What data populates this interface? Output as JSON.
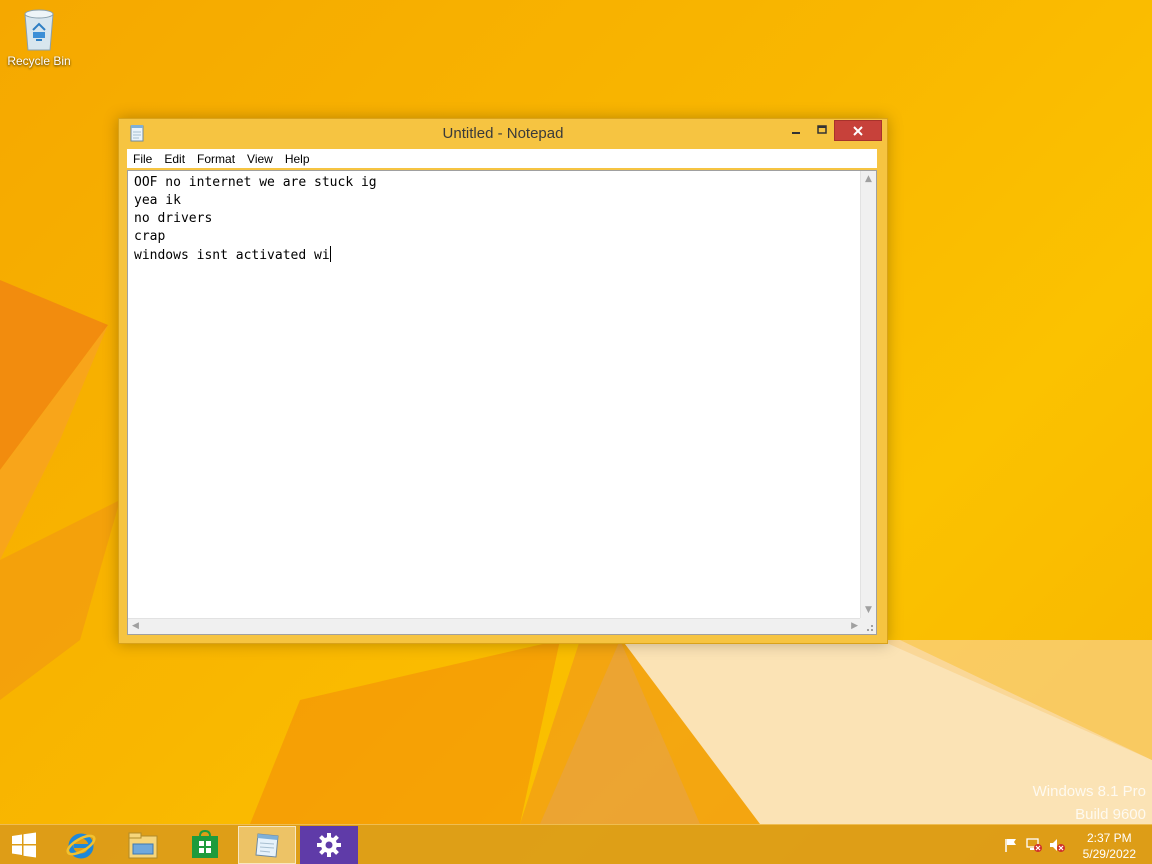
{
  "desktop": {
    "icons": [
      {
        "label": "Recycle Bin",
        "icon": "recycle-bin-icon"
      }
    ],
    "watermark": {
      "line1": "Windows 8.1 Pro",
      "line2": "Build 9600"
    }
  },
  "notepad": {
    "title": "Untitled - Notepad",
    "menu": [
      "File",
      "Edit",
      "Format",
      "View",
      "Help"
    ],
    "content_lines": [
      "OOF no internet we are stuck ig",
      "yea ik",
      "no drivers",
      "crap",
      "windows isnt activated wi"
    ],
    "close_color": "#c7413a"
  },
  "taskbar": {
    "buttons": [
      {
        "icon": "windows-start-icon",
        "active": false
      },
      {
        "icon": "internet-explorer-icon",
        "active": false
      },
      {
        "icon": "file-explorer-icon",
        "active": false
      },
      {
        "icon": "store-icon",
        "active": false
      },
      {
        "icon": "notepad-icon",
        "active": true
      },
      {
        "icon": "settings-gear-icon",
        "active": false
      }
    ],
    "tray": [
      "action-center-flag-icon",
      "network-disconnected-icon",
      "volume-muted-icon"
    ],
    "clock": {
      "time": "2:37 PM",
      "date": "5/29/2022"
    }
  }
}
